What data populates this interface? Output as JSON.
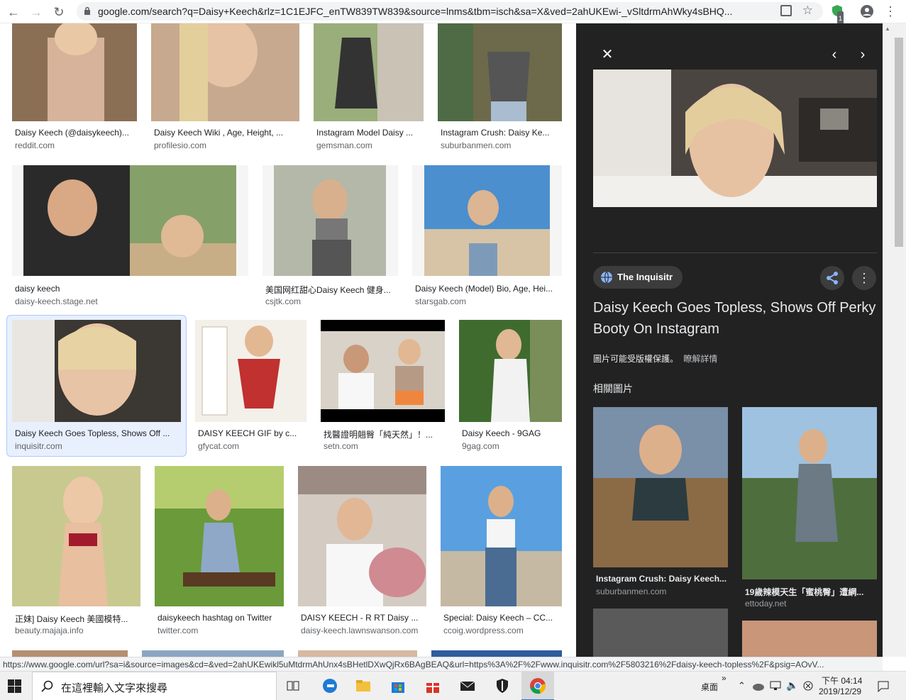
{
  "browser": {
    "url": "google.com/search?q=Daisy+Keech&rlz=1C1EJFC_enTW839TW839&source=lnms&tbm=isch&sa=X&ved=2ahUKEwi-_vSltdrmAhWky4sBHQ...",
    "extension_badge": "1"
  },
  "results": [
    {
      "caption": "Daisy Keech (@daisykeech)...",
      "source": "reddit.com"
    },
    {
      "caption": "Daisy Keech Wiki , Age, Height, ...",
      "source": "profilesio.com"
    },
    {
      "caption": "Instagram Model Daisy ...",
      "source": "gemsman.com"
    },
    {
      "caption": "Instagram Crush: Daisy Ke...",
      "source": "suburbanmen.com"
    },
    {
      "caption": "daisy keech",
      "source": "daisy-keech.stage.net"
    },
    {
      "caption": "美国网红甜心Daisy Keech 健身...",
      "source": "csjtk.com"
    },
    {
      "caption": "Daisy Keech (Model) Bio, Age, Hei...",
      "source": "starsgab.com"
    },
    {
      "caption": "Daisy Keech Goes Topless, Shows Off ...",
      "source": "inquisitr.com"
    },
    {
      "caption": "DAISY KEECH GIF by c...",
      "source": "gfycat.com"
    },
    {
      "caption": "找醫證明翹臀「純天然」！...",
      "source": "setn.com"
    },
    {
      "caption": "Daisy Keech - 9GAG",
      "source": "9gag.com"
    },
    {
      "caption": "正妹] Daisy Keech 美國模特...",
      "source": "beauty.majaja.info"
    },
    {
      "caption": "daisykeech hashtag on Twitter",
      "source": "twitter.com"
    },
    {
      "caption": "DAISY KEECH - R RT Daisy ...",
      "source": "daisy-keech.lawnswanson.com"
    },
    {
      "caption": "Special: Daisy Keech – CC...",
      "source": "ccoig.wordpress.com"
    }
  ],
  "panel": {
    "source_name": "The Inquisitr",
    "title": "Daisy Keech Goes Topless, Shows Off Perky Booty On Instagram",
    "copyright": "圖片可能受版權保護。",
    "learn_more": "瞭解詳情",
    "related_heading": "相關圖片",
    "related": [
      {
        "caption": "Instagram Crush: Daisy Keech...",
        "source": "suburbanmen.com"
      },
      {
        "caption": "19歲辣模天生「蜜桃臀」遭網...",
        "source": "ettoday.net"
      }
    ]
  },
  "status_url": "https://www.google.com/url?sa=i&source=images&cd=&ved=2ahUKEwikl5uMtdrmAhUnx4sBHetlDXwQjRx6BAgBEAQ&url=https%3A%2F%2Fwww.inquisitr.com%2F5803216%2Fdaisy-keech-topless%2F&psig=AOvV...",
  "taskbar": {
    "search_placeholder": "在這裡輸入文字來搜尋",
    "desktop_label": "桌面",
    "time": "下午 04:14",
    "date": "2019/12/29"
  },
  "colors": {
    "panel_bg": "#222222",
    "selected_border": "#aecbfa",
    "link": "#5f6368"
  }
}
